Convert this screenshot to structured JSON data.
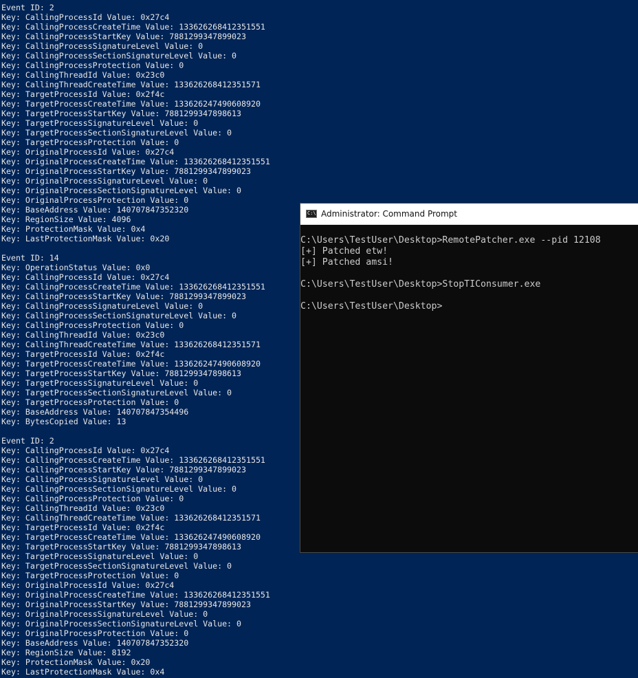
{
  "console": {
    "lines": [
      "Event ID: 2",
      "Key: CallingProcessId Value: 0x27c4",
      "Key: CallingProcessCreateTime Value: 133626268412351551",
      "Key: CallingProcessStartKey Value: 7881299347899023",
      "Key: CallingProcessSignatureLevel Value: 0",
      "Key: CallingProcessSectionSignatureLevel Value: 0",
      "Key: CallingProcessProtection Value: 0",
      "Key: CallingThreadId Value: 0x23c0",
      "Key: CallingThreadCreateTime Value: 133626268412351571",
      "Key: TargetProcessId Value: 0x2f4c",
      "Key: TargetProcessCreateTime Value: 133626247490608920",
      "Key: TargetProcessStartKey Value: 7881299347898613",
      "Key: TargetProcessSignatureLevel Value: 0",
      "Key: TargetProcessSectionSignatureLevel Value: 0",
      "Key: TargetProcessProtection Value: 0",
      "Key: OriginalProcessId Value: 0x27c4",
      "Key: OriginalProcessCreateTime Value: 133626268412351551",
      "Key: OriginalProcessStartKey Value: 7881299347899023",
      "Key: OriginalProcessSignatureLevel Value: 0",
      "Key: OriginalProcessSectionSignatureLevel Value: 0",
      "Key: OriginalProcessProtection Value: 0",
      "Key: BaseAddress Value: 140707847352320",
      "Key: RegionSize Value: 4096",
      "Key: ProtectionMask Value: 0x4",
      "Key: LastProtectionMask Value: 0x20",
      "",
      "Event ID: 14",
      "Key: OperationStatus Value: 0x0",
      "Key: CallingProcessId Value: 0x27c4",
      "Key: CallingProcessCreateTime Value: 133626268412351551",
      "Key: CallingProcessStartKey Value: 7881299347899023",
      "Key: CallingProcessSignatureLevel Value: 0",
      "Key: CallingProcessSectionSignatureLevel Value: 0",
      "Key: CallingProcessProtection Value: 0",
      "Key: CallingThreadId Value: 0x23c0",
      "Key: CallingThreadCreateTime Value: 133626268412351571",
      "Key: TargetProcessId Value: 0x2f4c",
      "Key: TargetProcessCreateTime Value: 133626247490608920",
      "Key: TargetProcessStartKey Value: 7881299347898613",
      "Key: TargetProcessSignatureLevel Value: 0",
      "Key: TargetProcessSectionSignatureLevel Value: 0",
      "Key: TargetProcessProtection Value: 0",
      "Key: BaseAddress Value: 140707847354496",
      "Key: BytesCopied Value: 13",
      "",
      "Event ID: 2",
      "Key: CallingProcessId Value: 0x27c4",
      "Key: CallingProcessCreateTime Value: 133626268412351551",
      "Key: CallingProcessStartKey Value: 7881299347899023",
      "Key: CallingProcessSignatureLevel Value: 0",
      "Key: CallingProcessSectionSignatureLevel Value: 0",
      "Key: CallingProcessProtection Value: 0",
      "Key: CallingThreadId Value: 0x23c0",
      "Key: CallingThreadCreateTime Value: 133626268412351571",
      "Key: TargetProcessId Value: 0x2f4c",
      "Key: TargetProcessCreateTime Value: 133626247490608920",
      "Key: TargetProcessStartKey Value: 7881299347898613",
      "Key: TargetProcessSignatureLevel Value: 0",
      "Key: TargetProcessSectionSignatureLevel Value: 0",
      "Key: TargetProcessProtection Value: 0",
      "Key: OriginalProcessId Value: 0x27c4",
      "Key: OriginalProcessCreateTime Value: 133626268412351551",
      "Key: OriginalProcessStartKey Value: 7881299347899023",
      "Key: OriginalProcessSignatureLevel Value: 0",
      "Key: OriginalProcessSectionSignatureLevel Value: 0",
      "Key: OriginalProcessProtection Value: 0",
      "Key: BaseAddress Value: 140707847352320",
      "Key: RegionSize Value: 8192",
      "Key: ProtectionMask Value: 0x20",
      "Key: LastProtectionMask Value: 0x4"
    ]
  },
  "cmd_window": {
    "title": "Administrator: Command Prompt",
    "icon": "cmd-icon",
    "lines": [
      "C:\\Users\\TestUser\\Desktop>RemotePatcher.exe --pid 12108",
      "[+] Patched etw!",
      "[+] Patched amsi!",
      "",
      "C:\\Users\\TestUser\\Desktop>StopTIConsumer.exe",
      "",
      "C:\\Users\\TestUser\\Desktop>"
    ]
  },
  "colors": {
    "console_background": "#012456",
    "console_text": "#e8e8e8",
    "cmd_background": "#0c0c0c",
    "cmd_text": "#cccccc",
    "titlebar_background": "#ffffff"
  }
}
